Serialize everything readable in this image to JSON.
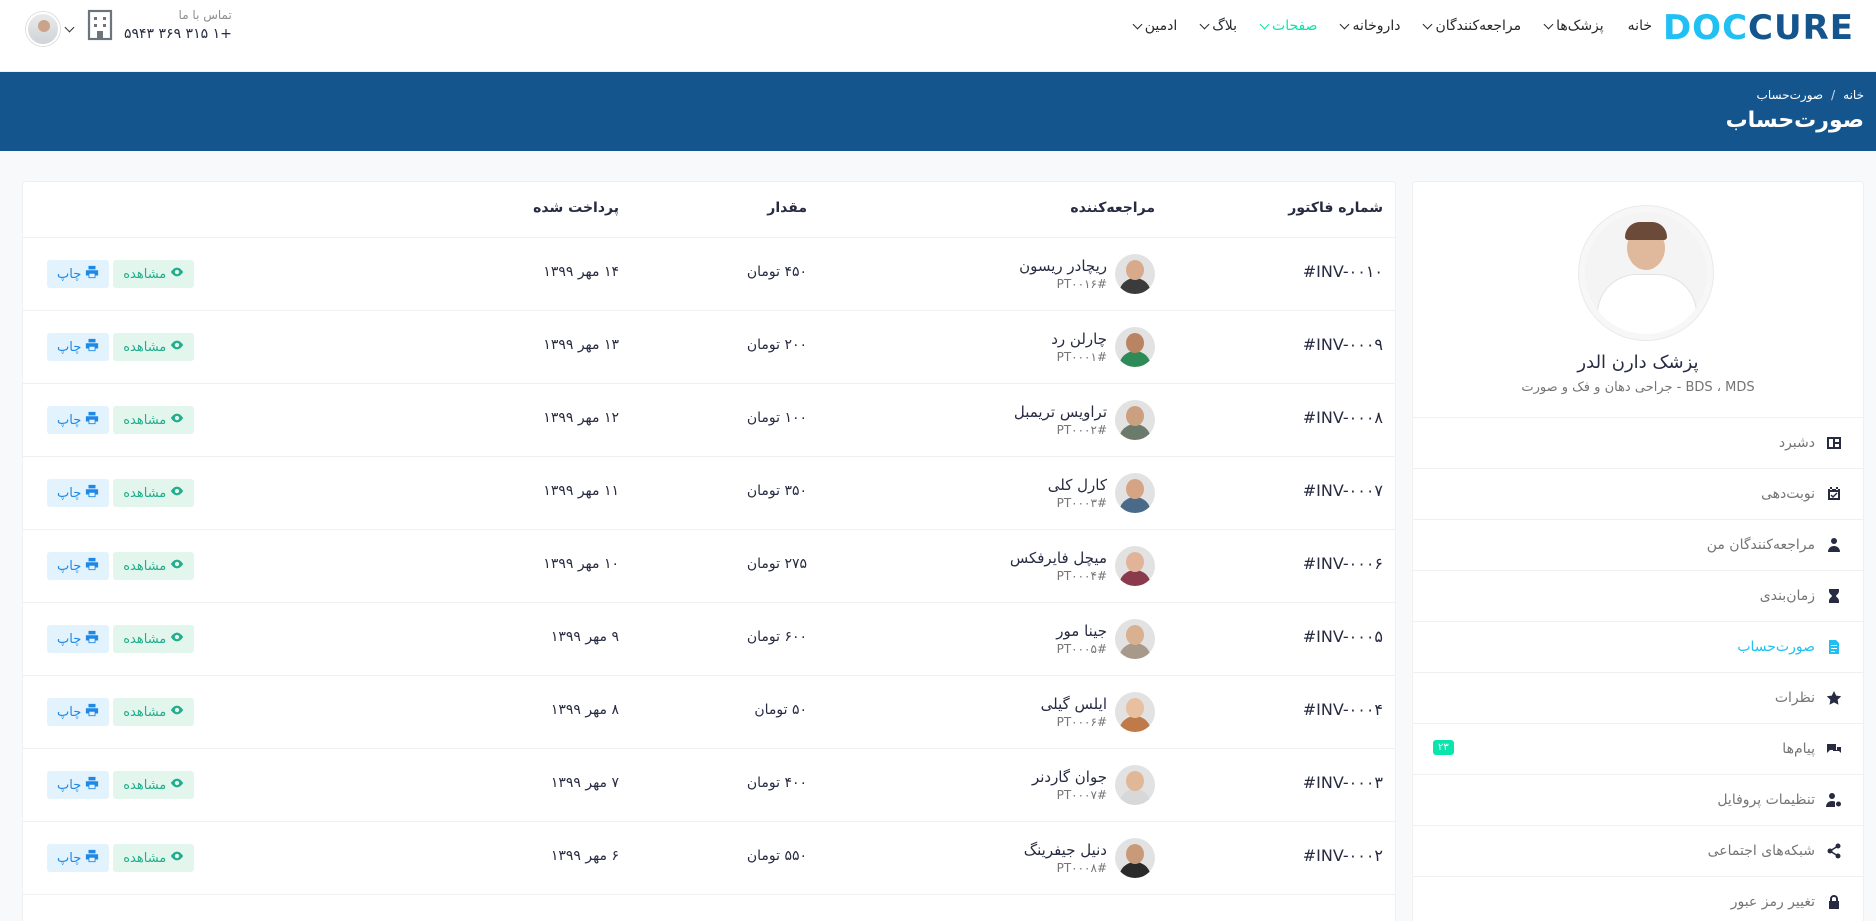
{
  "header": {
    "logo": {
      "doc": "DOC",
      "cure": "CURE"
    },
    "nav": [
      {
        "label": "خانه",
        "chevron": false,
        "active": false
      },
      {
        "label": "پزشک‌ها",
        "chevron": true,
        "active": false
      },
      {
        "label": "مراجعه‌کنندگان",
        "chevron": true,
        "active": false
      },
      {
        "label": "داروخانه",
        "chevron": true,
        "active": false
      },
      {
        "label": "صفحات",
        "chevron": true,
        "active": true
      },
      {
        "label": "بلاگ",
        "chevron": true,
        "active": false
      },
      {
        "label": "ادمین",
        "chevron": true,
        "active": false
      }
    ],
    "contact_label": "تماس با ما",
    "contact_phone": "+۱ ۳۱۵ ۳۶۹ ۵۹۴۳"
  },
  "breadcrumb": {
    "home": "خانه",
    "current": "صورت‌حساب",
    "separator": "/"
  },
  "page_title": "صورت‌حساب",
  "profile": {
    "name": "پزشک دارن الدر",
    "specialty": "BDS ، MDS - جراحی دهان و فک و صورت"
  },
  "sidebar": {
    "items": [
      {
        "label": "دشبرد",
        "icon": "dashboard-icon",
        "active": false
      },
      {
        "label": "نوبت‌دهی",
        "icon": "calendar-check-icon",
        "active": false
      },
      {
        "label": "مراجعه‌کنندگان من",
        "icon": "user-injured-icon",
        "active": false
      },
      {
        "label": "زمان‌بندی",
        "icon": "hourglass-icon",
        "active": false
      },
      {
        "label": "صورت‌حساب",
        "icon": "file-invoice-icon",
        "active": true
      },
      {
        "label": "نظرات",
        "icon": "star-icon",
        "active": false
      },
      {
        "label": "پیام‌ها",
        "icon": "comments-icon",
        "active": false,
        "badge": "۲۳"
      },
      {
        "label": "تنظیمات پروفایل",
        "icon": "user-cog-icon",
        "active": false
      },
      {
        "label": "شبکه‌های اجتماعی",
        "icon": "share-alt-icon",
        "active": false
      },
      {
        "label": "تغییر رمز عبور",
        "icon": "lock-icon",
        "active": false
      }
    ]
  },
  "table": {
    "headers": {
      "invoice": "شماره فاکتور",
      "patient": "مراجعه‌کننده",
      "amount": "مقدار",
      "paid_on": "پرداخت شده"
    },
    "view_label": "مشاهده",
    "print_label": "چاپ",
    "rows": [
      {
        "invoice": "#INV-۰۰۱۰",
        "name": "ریچادر ریسون",
        "pid": "#PT۰۰۱۶",
        "amount": "۴۵۰ تومان",
        "date": "۱۴ مهر ۱۳۹۹",
        "skin": "#d8a98a",
        "shirt": "#3b3b3b"
      },
      {
        "invoice": "#INV-۰۰۰۹",
        "name": "چارلن رد",
        "pid": "#PT۰۰۰۱",
        "amount": "۲۰۰ تومان",
        "date": "۱۳ مهر ۱۳۹۹",
        "skin": "#b98462",
        "shirt": "#2e8b57"
      },
      {
        "invoice": "#INV-۰۰۰۸",
        "name": "تراویس تریمبل",
        "pid": "#PT۰۰۰۲",
        "amount": "۱۰۰ تومان",
        "date": "۱۲ مهر ۱۳۹۹",
        "skin": "#caa080",
        "shirt": "#6b7b6b"
      },
      {
        "invoice": "#INV-۰۰۰۷",
        "name": "کارل کلی",
        "pid": "#PT۰۰۰۳",
        "amount": "۳۵۰ تومان",
        "date": "۱۱ مهر ۱۳۹۹",
        "skin": "#d4a484",
        "shirt": "#4a6a8a"
      },
      {
        "invoice": "#INV-۰۰۰۶",
        "name": "میچل فایرفکس",
        "pid": "#PT۰۰۰۴",
        "amount": "۲۷۵ تومان",
        "date": "۱۰ مهر ۱۳۹۹",
        "skin": "#e1b49a",
        "shirt": "#8a3a4a"
      },
      {
        "invoice": "#INV-۰۰۰۵",
        "name": "جینا مور",
        "pid": "#PT۰۰۰۵",
        "amount": "۶۰۰ تومان",
        "date": "۹ مهر ۱۳۹۹",
        "skin": "#d9b090",
        "shirt": "#a89a8a"
      },
      {
        "invoice": "#INV-۰۰۰۴",
        "name": "ایلس گیلی",
        "pid": "#PT۰۰۰۶",
        "amount": "۵۰ تومان",
        "date": "۸ مهر ۱۳۹۹",
        "skin": "#e8c0a0",
        "shirt": "#c07a4a"
      },
      {
        "invoice": "#INV-۰۰۰۳",
        "name": "جوان گاردنر",
        "pid": "#PT۰۰۰۷",
        "amount": "۴۰۰ تومان",
        "date": "۷ مهر ۱۳۹۹",
        "skin": "#e0b898",
        "shirt": "#d8d8d8"
      },
      {
        "invoice": "#INV-۰۰۰۲",
        "name": "دنیل جیفرینگ",
        "pid": "#PT۰۰۰۸",
        "amount": "۵۵۰ تومان",
        "date": "۶ مهر ۱۳۹۹",
        "skin": "#c99a7a",
        "shirt": "#2a2a2a"
      }
    ]
  },
  "colors": {
    "primary": "#15558d",
    "accent": "#20c0f3",
    "green": "#09e5ab"
  }
}
